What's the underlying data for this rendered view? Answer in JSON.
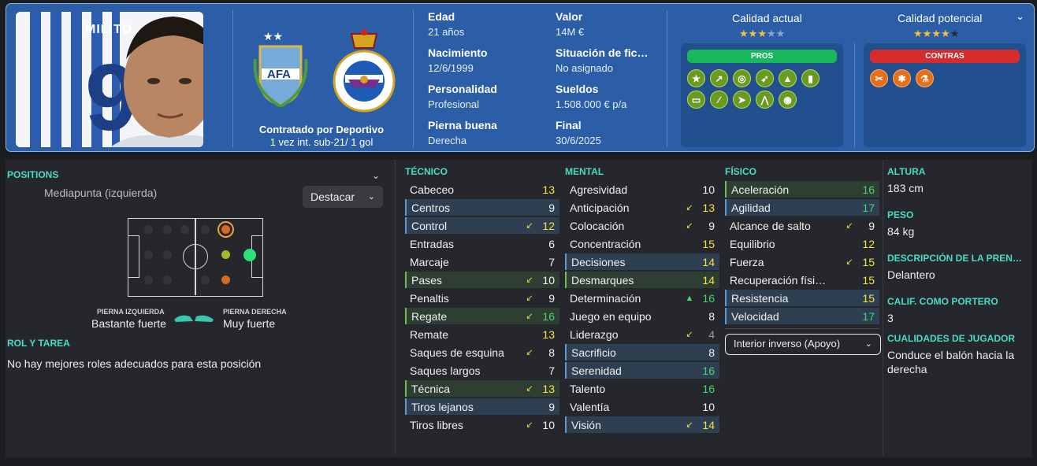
{
  "player": {
    "name_fragment": "MILITO",
    "contract_line1": "Contratado por Deportivo",
    "contract_line2": "1 vez int. sub-21/ 1 gol"
  },
  "info_col1": [
    {
      "label": "Edad",
      "value": "21 años"
    },
    {
      "label": "Nacimiento",
      "value": "12/6/1999"
    },
    {
      "label": "Personalidad",
      "value": "Profesional"
    },
    {
      "label": "Pierna buena",
      "value": "Derecha"
    }
  ],
  "info_col2": [
    {
      "label": "Valor",
      "value": "14M €"
    },
    {
      "label": "Situación de fic…",
      "value": "No asignado"
    },
    {
      "label": "Sueldos",
      "value": "1.508.000 € p/a"
    },
    {
      "label": "Final",
      "value": "30/6/2025"
    }
  ],
  "quality": {
    "current_label": "Calidad actual",
    "current_stars": 3,
    "potential_label": "Calidad potencial",
    "potential_stars": 4,
    "max_stars": 5
  },
  "pros": {
    "label": "PROS",
    "color": "#18b95a",
    "traits": [
      "star-icon",
      "trend-icon",
      "target-icon",
      "boots-icon",
      "cone-icon",
      "bottle-icon",
      "pitch-icon",
      "bandage-icon",
      "sprint-icon",
      "agility-icon",
      "brain-icon"
    ]
  },
  "contras": {
    "label": "CONTRAS",
    "color": "#d62c2c",
    "traits": [
      "tendon-icon",
      "injury-icon",
      "flask-icon"
    ]
  },
  "positions": {
    "heading": "POSITIONS",
    "position": "Mediapunta (izquierda)",
    "highlight_button": "Destacar",
    "left_foot_label": "PIERNA IZQUIERDA",
    "left_foot_value": "Bastante fuerte",
    "right_foot_label": "PIERNA DERECHA",
    "right_foot_value": "Muy fuerte"
  },
  "role": {
    "heading": "ROL Y TAREA",
    "text": "No hay mejores roles adecuados para esta posición",
    "selector": "Interior inverso (Apoyo)"
  },
  "tecnico": {
    "heading": "TÉCNICO",
    "attrs": [
      {
        "name": "Cabeceo",
        "value": "13",
        "arrow": ""
      },
      {
        "name": "Centros",
        "value": "9",
        "arrow": ""
      },
      {
        "name": "Control",
        "value": "12",
        "arrow": "↙"
      },
      {
        "name": "Entradas",
        "value": "6",
        "arrow": ""
      },
      {
        "name": "Marcaje",
        "value": "7",
        "arrow": ""
      },
      {
        "name": "Pases",
        "value": "10",
        "arrow": "↙"
      },
      {
        "name": "Penaltis",
        "value": "9",
        "arrow": "↙"
      },
      {
        "name": "Regate",
        "value": "16",
        "arrow": "↙"
      },
      {
        "name": "Remate",
        "value": "13",
        "arrow": ""
      },
      {
        "name": "Saques de esquina",
        "value": "8",
        "arrow": "↙"
      },
      {
        "name": "Saques largos",
        "value": "7",
        "arrow": ""
      },
      {
        "name": "Técnica",
        "value": "13",
        "arrow": "↙"
      },
      {
        "name": "Tiros lejanos",
        "value": "9",
        "arrow": ""
      },
      {
        "name": "Tiros libres",
        "value": "10",
        "arrow": "↙"
      }
    ]
  },
  "mental": {
    "heading": "MENTAL",
    "attrs": [
      {
        "name": "Agresividad",
        "value": "10",
        "arrow": ""
      },
      {
        "name": "Anticipación",
        "value": "13",
        "arrow": "↙"
      },
      {
        "name": "Colocación",
        "value": "9",
        "arrow": "↙"
      },
      {
        "name": "Concentración",
        "value": "15",
        "arrow": ""
      },
      {
        "name": "Decisiones",
        "value": "14",
        "arrow": ""
      },
      {
        "name": "Desmarques",
        "value": "14",
        "arrow": ""
      },
      {
        "name": "Determinación",
        "value": "16",
        "arrow": "▲"
      },
      {
        "name": "Juego en equipo",
        "value": "8",
        "arrow": ""
      },
      {
        "name": "Liderazgo",
        "value": "4",
        "arrow": "↙"
      },
      {
        "name": "Sacrificio",
        "value": "8",
        "arrow": ""
      },
      {
        "name": "Serenidad",
        "value": "16",
        "arrow": ""
      },
      {
        "name": "Talento",
        "value": "16",
        "arrow": ""
      },
      {
        "name": "Valentía",
        "value": "10",
        "arrow": ""
      },
      {
        "name": "Visión",
        "value": "14",
        "arrow": "↙"
      }
    ]
  },
  "fisico": {
    "heading": "FÍSICO",
    "attrs": [
      {
        "name": "Aceleración",
        "value": "16",
        "arrow": ""
      },
      {
        "name": "Agilidad",
        "value": "17",
        "arrow": ""
      },
      {
        "name": "Alcance de salto",
        "value": "9",
        "arrow": "↙"
      },
      {
        "name": "Equilibrio",
        "value": "12",
        "arrow": ""
      },
      {
        "name": "Fuerza",
        "value": "15",
        "arrow": "↙"
      },
      {
        "name": "Recuperación físi…",
        "value": "15",
        "arrow": ""
      },
      {
        "name": "Resistencia",
        "value": "15",
        "arrow": ""
      },
      {
        "name": "Velocidad",
        "value": "17",
        "arrow": ""
      }
    ]
  },
  "side": [
    {
      "label": "ALTURA",
      "value": "183 cm"
    },
    {
      "label": "PESO",
      "value": "84 kg"
    },
    {
      "label": "DESCRIPCIÓN DE LA PREN…",
      "value": "Delantero"
    },
    {
      "label": "CALIF. COMO PORTERO",
      "value": "3"
    },
    {
      "label": "CUALIDADES DE JUGADOR",
      "value": "Conduce el balón hacia la derecha"
    }
  ]
}
